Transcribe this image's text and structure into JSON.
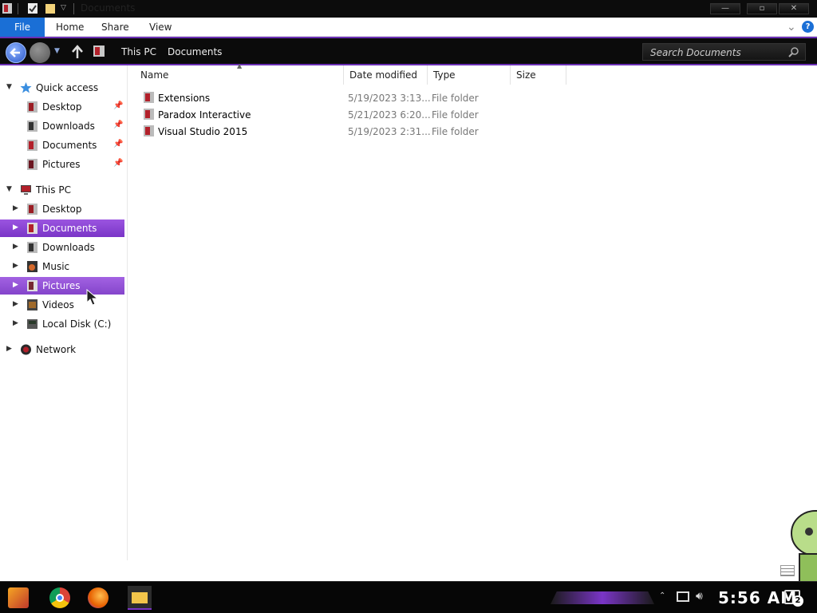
{
  "window": {
    "title": "Documents",
    "controls": {
      "minimize": "—",
      "maximize": "▫",
      "close": "✕"
    }
  },
  "ribbon": {
    "tabs": [
      "File",
      "Home",
      "Share",
      "View"
    ],
    "expand_glyph": "⌄",
    "help_glyph": "?"
  },
  "address": {
    "breadcrumbs": [
      "This PC",
      "Documents"
    ],
    "search_placeholder": "Search Documents"
  },
  "nav": {
    "quick_access": {
      "label": "Quick access",
      "items": [
        "Desktop",
        "Downloads",
        "Documents",
        "Pictures"
      ]
    },
    "this_pc": {
      "label": "This PC",
      "items": [
        "Desktop",
        "Documents",
        "Downloads",
        "Music",
        "Pictures",
        "Videos",
        "Local Disk (C:)"
      ],
      "selected": "Documents",
      "hovered": "Pictures"
    },
    "network": {
      "label": "Network"
    }
  },
  "columns": [
    "Name",
    "Date modified",
    "Type",
    "Size"
  ],
  "files": [
    {
      "name": "Extensions",
      "date": "5/19/2023 3:13...",
      "type": "File folder",
      "size": ""
    },
    {
      "name": "Paradox Interactive",
      "date": "5/21/2023 6:20...",
      "type": "File folder",
      "size": ""
    },
    {
      "name": "Visual Studio 2015",
      "date": "5/19/2023 2:31...",
      "type": "File folder",
      "size": ""
    }
  ],
  "taskbar": {
    "clock": "5:56 AM",
    "notification_count": "2"
  },
  "colors": {
    "accent_purple": "#7a35c7",
    "file_tab_blue": "#1a6fd6",
    "chrome_dark": "#0b0b0b"
  }
}
